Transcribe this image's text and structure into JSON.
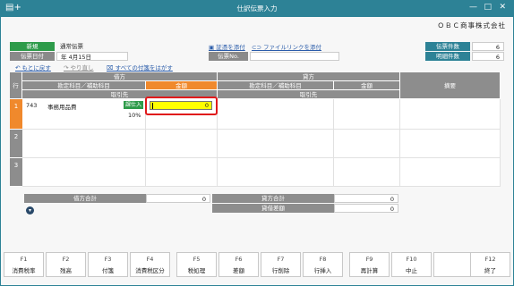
{
  "window": {
    "title": "仕訳伝票入力",
    "company": "ＯＢＣ商事株式会社"
  },
  "header": {
    "new_label": "新規",
    "slip_type": "通常伝票",
    "date_label": "伝票日付",
    "date_value": "年  4月15日",
    "attach_slip": "証憑を添付",
    "attach_file_link": "ファイルリンクを添付",
    "slip_no_label": "伝票No.",
    "undo": "もとに戻す",
    "redo": "やり直し",
    "remove_all": "すべての付箋をはがす",
    "slip_count_label": "伝票件数",
    "slip_count": "6",
    "detail_count_label": "明細件数",
    "detail_count": "6"
  },
  "grid": {
    "row_header": "行",
    "debit": "借方",
    "credit": "貸方",
    "account_sub": "勘定科目／補助科目",
    "amount": "金額",
    "client": "取引先",
    "summary": "摘要",
    "rows": [
      {
        "num": "1",
        "code": "743",
        "account": "事務用品費",
        "tax_badge": "課仕入",
        "tax_rate": "10%",
        "amount": "0"
      },
      {
        "num": "2"
      },
      {
        "num": "3"
      }
    ]
  },
  "totals": {
    "debit_total_label": "借方合計",
    "debit_total": "0",
    "credit_total_label": "貸方合計",
    "credit_total": "0",
    "diff_label": "貸借差額",
    "diff": "0"
  },
  "fkeys": [
    {
      "key": "F1",
      "label": "消費税率"
    },
    {
      "key": "F2",
      "label": "残高"
    },
    {
      "key": "F3",
      "label": "付箋"
    },
    {
      "key": "F4",
      "label": "消費税区分"
    },
    {
      "key": "F5",
      "label": "税処理"
    },
    {
      "key": "F6",
      "label": "差額"
    },
    {
      "key": "F7",
      "label": "行削除"
    },
    {
      "key": "F8",
      "label": "行挿入"
    },
    {
      "key": "F9",
      "label": "再計算"
    },
    {
      "key": "F10",
      "label": "中止"
    },
    {
      "key": "",
      "label": ""
    },
    {
      "key": "F12",
      "label": "終了"
    }
  ]
}
